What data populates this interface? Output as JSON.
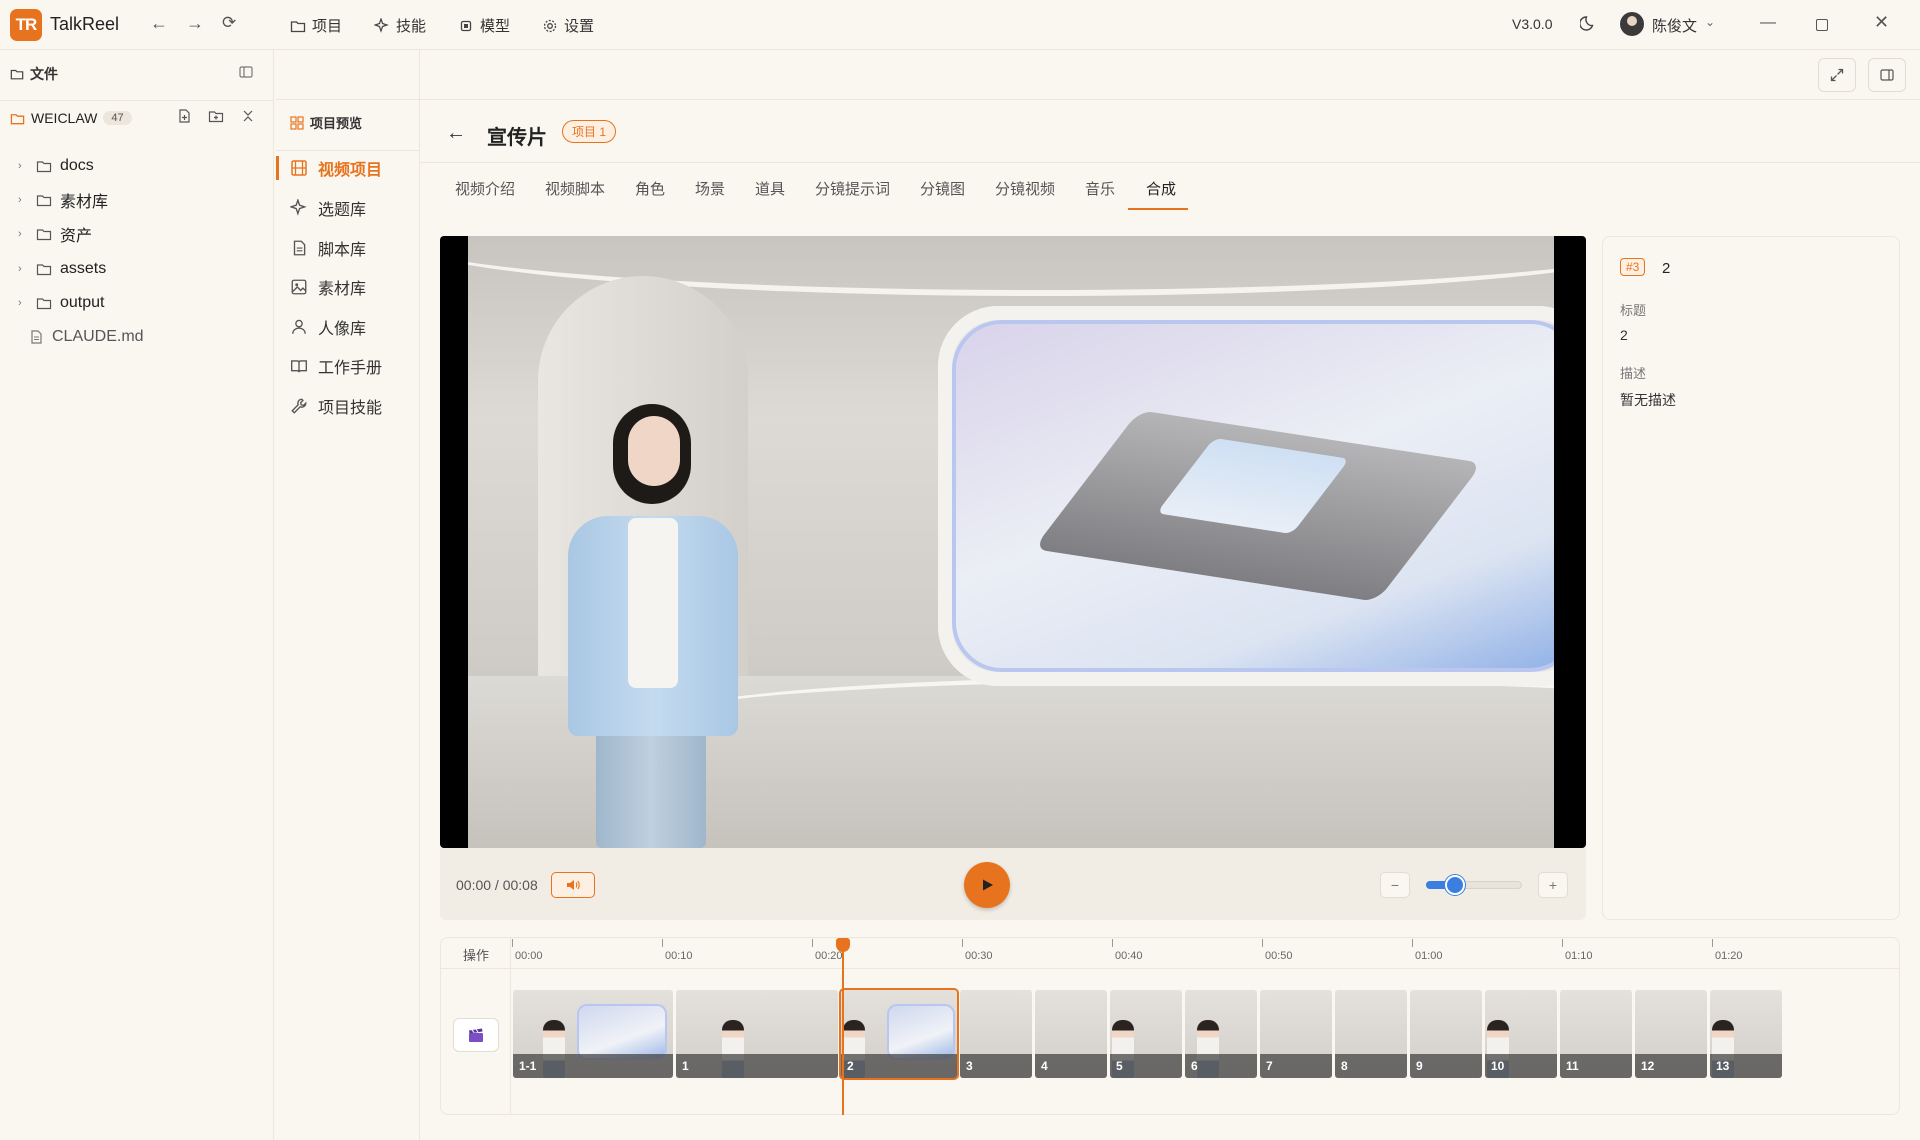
{
  "app": {
    "name": "TalkReel",
    "logo_text": "TR",
    "version": "V3.0.0",
    "user": "陈俊文"
  },
  "menu": [
    {
      "label": "项目",
      "icon": "folder-icon"
    },
    {
      "label": "技能",
      "icon": "sparkle-icon"
    },
    {
      "label": "模型",
      "icon": "chip-icon"
    },
    {
      "label": "设置",
      "icon": "gear-icon"
    }
  ],
  "files": {
    "header": "文件",
    "workspace": "WEICLAW",
    "workspace_count": "47",
    "tree": [
      {
        "label": "docs",
        "type": "folder"
      },
      {
        "label": "素材库",
        "type": "folder"
      },
      {
        "label": "资产",
        "type": "folder"
      },
      {
        "label": "assets",
        "type": "folder"
      },
      {
        "label": "output",
        "type": "folder"
      },
      {
        "label": "CLAUDE.md",
        "type": "file"
      }
    ]
  },
  "project_nav": {
    "header": "项目预览",
    "items": [
      {
        "label": "视频项目",
        "icon": "film-icon",
        "active": true
      },
      {
        "label": "选题库",
        "icon": "sparkle-icon"
      },
      {
        "label": "脚本库",
        "icon": "document-icon"
      },
      {
        "label": "素材库",
        "icon": "image-icon"
      },
      {
        "label": "人像库",
        "icon": "person-icon"
      },
      {
        "label": "工作手册",
        "icon": "book-icon"
      },
      {
        "label": "项目技能",
        "icon": "wrench-icon"
      }
    ]
  },
  "project": {
    "back": "←",
    "title": "宣传片",
    "tag": "项目 1"
  },
  "tabs": [
    "视频介绍",
    "视频脚本",
    "角色",
    "场景",
    "道具",
    "分镜提示词",
    "分镜图",
    "分镜视频",
    "音乐",
    "合成"
  ],
  "active_tab": "合成",
  "player": {
    "time": "00:00 / 00:08",
    "zoom_minus": "−",
    "zoom_plus": "+",
    "zoom_level": 0.3
  },
  "info": {
    "tag": "#3",
    "number": "2",
    "title_label": "标题",
    "title_value": "2",
    "desc_label": "描述",
    "desc_value": "暂无描述"
  },
  "timeline": {
    "op_label": "操作",
    "ticks": [
      "00:00",
      "00:10",
      "00:20",
      "00:30",
      "00:40",
      "00:50",
      "01:00",
      "01:10",
      "01:20"
    ],
    "clips": [
      "1-1",
      "1",
      "2",
      "3",
      "4",
      "5",
      "6",
      "7",
      "8",
      "9",
      "10",
      "11",
      "12",
      "13"
    ],
    "selected_clip": "2"
  },
  "colors": {
    "accent": "#e8731f",
    "slider": "#3a7fe0"
  }
}
